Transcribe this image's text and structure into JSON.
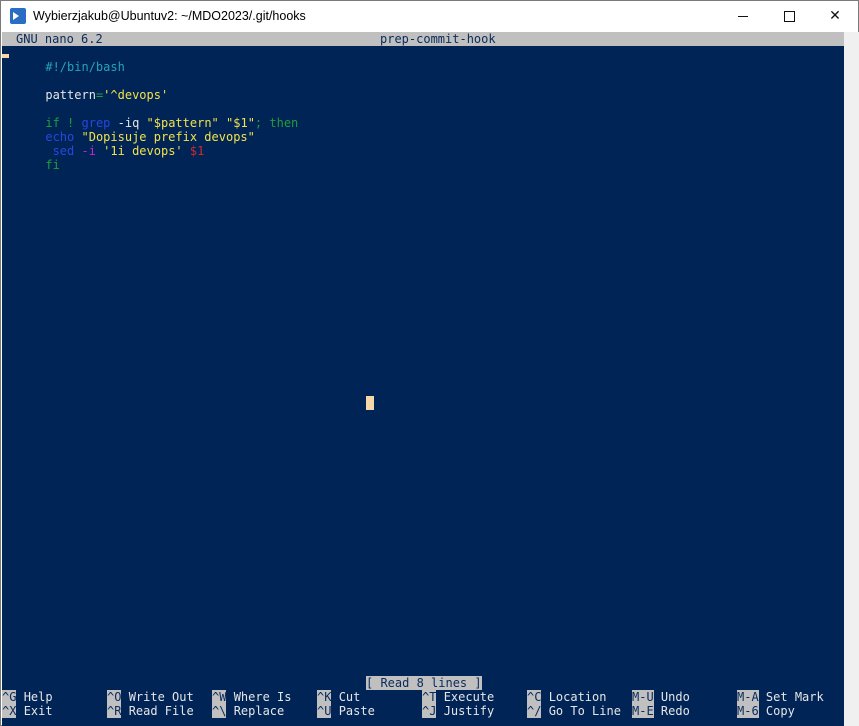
{
  "window": {
    "title": "Wybierzjakub@Ubuntuv2: ~/MDO2023/.git/hooks",
    "controls": {
      "minimize": "—",
      "maximize": "☐",
      "close": "✕"
    }
  },
  "nano": {
    "version": "GNU nano 6.2",
    "filename": "prep-commit-hook",
    "status": "[ Read 8 lines ]"
  },
  "code": {
    "l1": "#!/bin/bash",
    "l3_var": "pattern",
    "l3_eq": "=",
    "l3_val": "'^devops'",
    "l5_if": "if",
    "l5_not": " ! ",
    "l5_grep": "grep",
    "l5_flag": " -iq ",
    "l5_arg1": "\"$pattern\"",
    "l5_sp": " ",
    "l5_arg2": "\"$1\"",
    "l5_then": "; then",
    "l6_echo": "echo",
    "l6_str": " \"Dopisuje prefix devops\"",
    "l7_sed": " sed",
    "l7_flag": " -i",
    "l7_arg": " '1i devops'",
    "l7_var": " $1",
    "l8_fi": "fi"
  },
  "shortcuts": [
    {
      "key": "^G",
      "label": "Help"
    },
    {
      "key": "^X",
      "label": "Exit"
    },
    {
      "key": "^O",
      "label": "Write Out"
    },
    {
      "key": "^R",
      "label": "Read File"
    },
    {
      "key": "^W",
      "label": "Where Is"
    },
    {
      "key": "^\\",
      "label": "Replace"
    },
    {
      "key": "^K",
      "label": "Cut"
    },
    {
      "key": "^U",
      "label": "Paste"
    },
    {
      "key": "^T",
      "label": "Execute"
    },
    {
      "key": "^J",
      "label": "Justify"
    },
    {
      "key": "^C",
      "label": "Location"
    },
    {
      "key": "^/",
      "label": "Go To Line"
    },
    {
      "key": "M-U",
      "label": "Undo"
    },
    {
      "key": "M-E",
      "label": "Redo"
    },
    {
      "key": "M-A",
      "label": "Set Mark"
    },
    {
      "key": "M-6",
      "label": "Copy"
    }
  ],
  "colors": {
    "terminal_bg": "#012456",
    "bar_bg": "#c0c0c0",
    "comment": "#26a3b5",
    "keyword": "#1f9e3a",
    "string": "#f2e24b",
    "command": "#2747e0"
  }
}
